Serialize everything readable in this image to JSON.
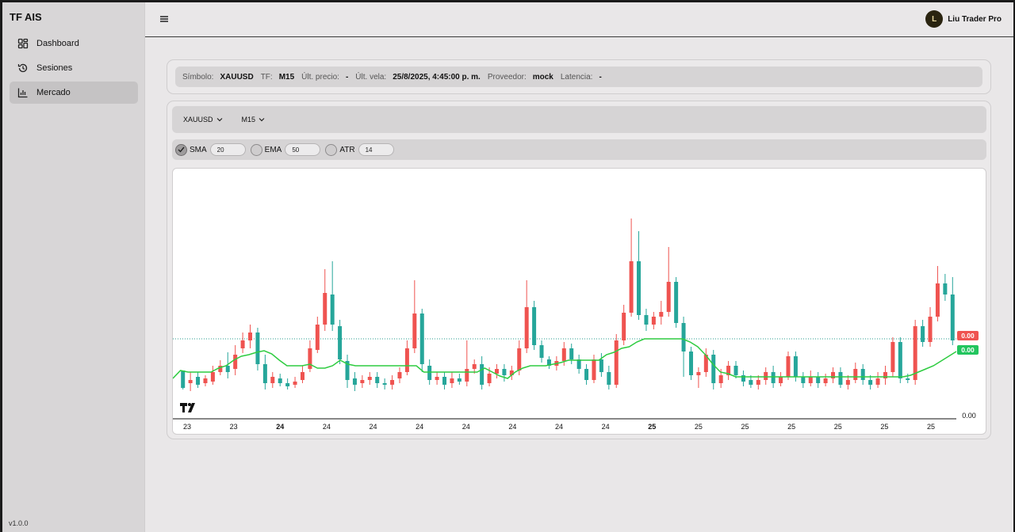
{
  "app": {
    "brand": "TF AIS",
    "version": "v1.0.0"
  },
  "sidebar": {
    "items": [
      {
        "label": "Dashboard",
        "icon": "dashboard-icon",
        "active": false
      },
      {
        "label": "Sesiones",
        "icon": "history-icon",
        "active": false
      },
      {
        "label": "Mercado",
        "icon": "chart-icon",
        "active": true
      }
    ]
  },
  "topbar": {
    "user_name": "Liu Trader Pro",
    "avatar_letter": "L"
  },
  "info": {
    "symbol_label": "Símbolo:",
    "symbol_value": "XAUUSD",
    "tf_label": "TF:",
    "tf_value": "M15",
    "last_price_label": "Últ. precio:",
    "last_price_value": "-",
    "last_candle_label": "Últ. vela:",
    "last_candle_value": "25/8/2025, 4:45:00 p. m.",
    "provider_label": "Proveedor:",
    "provider_value": "mock",
    "latency_label": "Latencia:",
    "latency_value": "-"
  },
  "selectors": {
    "symbol": "XAUUSD",
    "timeframe": "M15"
  },
  "indicators": [
    {
      "name": "SMA",
      "value": "20",
      "checked": true
    },
    {
      "name": "EMA",
      "value": "50",
      "checked": false
    },
    {
      "name": "ATR",
      "value": "14",
      "checked": false
    }
  ],
  "chart_data": {
    "type": "candlestick",
    "x_ticks": [
      {
        "label": "23",
        "bold": false
      },
      {
        "label": "23",
        "bold": false
      },
      {
        "label": "24",
        "bold": true
      },
      {
        "label": "24",
        "bold": false
      },
      {
        "label": "24",
        "bold": false
      },
      {
        "label": "24",
        "bold": false
      },
      {
        "label": "24",
        "bold": false
      },
      {
        "label": "24",
        "bold": false
      },
      {
        "label": "24",
        "bold": false
      },
      {
        "label": "24",
        "bold": false
      },
      {
        "label": "25",
        "bold": true
      },
      {
        "label": "25",
        "bold": false
      },
      {
        "label": "25",
        "bold": false
      },
      {
        "label": "25",
        "bold": false
      },
      {
        "label": "25",
        "bold": false
      },
      {
        "label": "25",
        "bold": false
      },
      {
        "label": "25",
        "bold": false
      }
    ],
    "price_axis_label": "0.00",
    "last_price_tag": "0.00",
    "sma_tag": "0.00",
    "colors": {
      "up": "#26a69a",
      "down": "#ef5350",
      "sma": "#2ecc40",
      "down_tag": "#ef5350",
      "up_tag": "#22c55e"
    },
    "sma_series": [
      478,
      468,
      470,
      470,
      470,
      470,
      465,
      462,
      455,
      450,
      448,
      445,
      443,
      447,
      455,
      462,
      462,
      462,
      460,
      465,
      465,
      462,
      455,
      460,
      462,
      462,
      462,
      462,
      462,
      462,
      462,
      462,
      462,
      470,
      470,
      470,
      470,
      470,
      470,
      470,
      470,
      465,
      470,
      475,
      478,
      470,
      465,
      462,
      462,
      462,
      460,
      458,
      455,
      455,
      455,
      455,
      455,
      448,
      445,
      440,
      438,
      432,
      428,
      428,
      428,
      428,
      428,
      428,
      432,
      438,
      448,
      460,
      470,
      472,
      476,
      476,
      476,
      476,
      476,
      476,
      476,
      476,
      476,
      476,
      476,
      476,
      476,
      476,
      476,
      476,
      476,
      476,
      476,
      476,
      476,
      476,
      476,
      474,
      470,
      466,
      462,
      456,
      450,
      444
    ],
    "candles": [
      [
        468,
        490,
        480,
        492,
        0
      ],
      [
        480,
        484,
        470,
        494,
        1
      ],
      [
        476,
        486,
        470,
        490,
        0
      ],
      [
        478,
        484,
        474,
        488,
        1
      ],
      [
        482,
        470,
        462,
        486,
        1
      ],
      [
        470,
        462,
        455,
        474,
        1
      ],
      [
        462,
        470,
        445,
        478,
        0
      ],
      [
        466,
        448,
        436,
        474,
        1
      ],
      [
        440,
        430,
        420,
        446,
        1
      ],
      [
        430,
        420,
        410,
        440,
        1
      ],
      [
        420,
        460,
        414,
        468,
        0
      ],
      [
        460,
        484,
        448,
        492,
        0
      ],
      [
        484,
        476,
        470,
        490,
        1
      ],
      [
        478,
        484,
        472,
        488,
        0
      ],
      [
        484,
        488,
        478,
        492,
        0
      ],
      [
        486,
        482,
        476,
        490,
        1
      ],
      [
        480,
        470,
        462,
        484,
        1
      ],
      [
        466,
        440,
        430,
        470,
        1
      ],
      [
        442,
        410,
        400,
        446,
        1
      ],
      [
        410,
        370,
        340,
        418,
        1
      ],
      [
        372,
        410,
        330,
        418,
        0
      ],
      [
        412,
        454,
        404,
        460,
        0
      ],
      [
        456,
        480,
        448,
        490,
        0
      ],
      [
        478,
        486,
        470,
        494,
        0
      ],
      [
        484,
        480,
        474,
        490,
        1
      ],
      [
        480,
        476,
        470,
        486,
        1
      ],
      [
        476,
        484,
        470,
        490,
        0
      ],
      [
        484,
        486,
        478,
        492,
        0
      ],
      [
        486,
        480,
        474,
        492,
        1
      ],
      [
        478,
        470,
        464,
        484,
        1
      ],
      [
        470,
        440,
        430,
        474,
        1
      ],
      [
        440,
        396,
        354,
        446,
        1
      ],
      [
        396,
        460,
        390,
        470,
        0
      ],
      [
        462,
        480,
        454,
        486,
        0
      ],
      [
        480,
        476,
        470,
        486,
        1
      ],
      [
        476,
        486,
        470,
        492,
        0
      ],
      [
        484,
        478,
        470,
        490,
        1
      ],
      [
        478,
        482,
        472,
        486,
        0
      ],
      [
        482,
        466,
        430,
        488,
        1
      ],
      [
        466,
        460,
        454,
        472,
        1
      ],
      [
        460,
        486,
        450,
        492,
        0
      ],
      [
        484,
        472,
        464,
        488,
        1
      ],
      [
        472,
        466,
        460,
        478,
        1
      ],
      [
        466,
        474,
        460,
        482,
        0
      ],
      [
        474,
        468,
        462,
        480,
        1
      ],
      [
        468,
        440,
        430,
        474,
        1
      ],
      [
        440,
        388,
        354,
        446,
        1
      ],
      [
        388,
        436,
        380,
        442,
        0
      ],
      [
        436,
        452,
        430,
        458,
        0
      ],
      [
        454,
        462,
        450,
        466,
        0
      ],
      [
        462,
        456,
        450,
        468,
        1
      ],
      [
        456,
        440,
        432,
        462,
        1
      ],
      [
        440,
        454,
        434,
        460,
        0
      ],
      [
        454,
        466,
        448,
        472,
        0
      ],
      [
        466,
        480,
        460,
        486,
        0
      ],
      [
        480,
        454,
        448,
        484,
        1
      ],
      [
        454,
        470,
        446,
        476,
        0
      ],
      [
        470,
        486,
        462,
        492,
        0
      ],
      [
        486,
        430,
        422,
        490,
        1
      ],
      [
        430,
        395,
        385,
        436,
        1
      ],
      [
        395,
        330,
        276,
        400,
        1
      ],
      [
        330,
        398,
        292,
        404,
        0
      ],
      [
        398,
        410,
        390,
        418,
        0
      ],
      [
        410,
        400,
        394,
        416,
        1
      ],
      [
        400,
        394,
        380,
        410,
        1
      ],
      [
        394,
        356,
        312,
        400,
        1
      ],
      [
        356,
        408,
        350,
        414,
        0
      ],
      [
        408,
        444,
        400,
        476,
        0
      ],
      [
        444,
        474,
        438,
        480,
        0
      ],
      [
        474,
        470,
        464,
        490,
        1
      ],
      [
        470,
        448,
        440,
        476,
        1
      ],
      [
        448,
        484,
        442,
        492,
        0
      ],
      [
        484,
        474,
        466,
        490,
        1
      ],
      [
        474,
        462,
        456,
        480,
        1
      ],
      [
        462,
        474,
        456,
        478,
        0
      ],
      [
        474,
        482,
        468,
        488,
        0
      ],
      [
        480,
        486,
        474,
        490,
        0
      ],
      [
        486,
        480,
        474,
        492,
        1
      ],
      [
        480,
        470,
        464,
        486,
        1
      ],
      [
        470,
        484,
        462,
        490,
        0
      ],
      [
        484,
        476,
        470,
        488,
        1
      ],
      [
        476,
        450,
        444,
        480,
        1
      ],
      [
        450,
        476,
        444,
        482,
        0
      ],
      [
        476,
        484,
        470,
        490,
        0
      ],
      [
        484,
        476,
        468,
        488,
        1
      ],
      [
        476,
        484,
        470,
        490,
        0
      ],
      [
        484,
        478,
        472,
        488,
        1
      ],
      [
        478,
        470,
        464,
        484,
        1
      ],
      [
        470,
        486,
        464,
        490,
        0
      ],
      [
        486,
        480,
        474,
        492,
        1
      ],
      [
        480,
        466,
        458,
        484,
        1
      ],
      [
        466,
        480,
        460,
        486,
        0
      ],
      [
        480,
        486,
        474,
        492,
        0
      ],
      [
        486,
        478,
        470,
        490,
        1
      ],
      [
        478,
        470,
        462,
        486,
        1
      ],
      [
        470,
        432,
        426,
        476,
        1
      ],
      [
        432,
        478,
        426,
        484,
        0
      ],
      [
        478,
        480,
        472,
        484,
        0
      ],
      [
        480,
        412,
        404,
        486,
        1
      ],
      [
        412,
        432,
        404,
        438,
        0
      ],
      [
        432,
        400,
        388,
        438,
        1
      ],
      [
        400,
        358,
        336,
        406,
        1
      ],
      [
        358,
        372,
        346,
        380,
        0
      ],
      [
        372,
        430,
        350,
        436,
        0
      ]
    ]
  }
}
